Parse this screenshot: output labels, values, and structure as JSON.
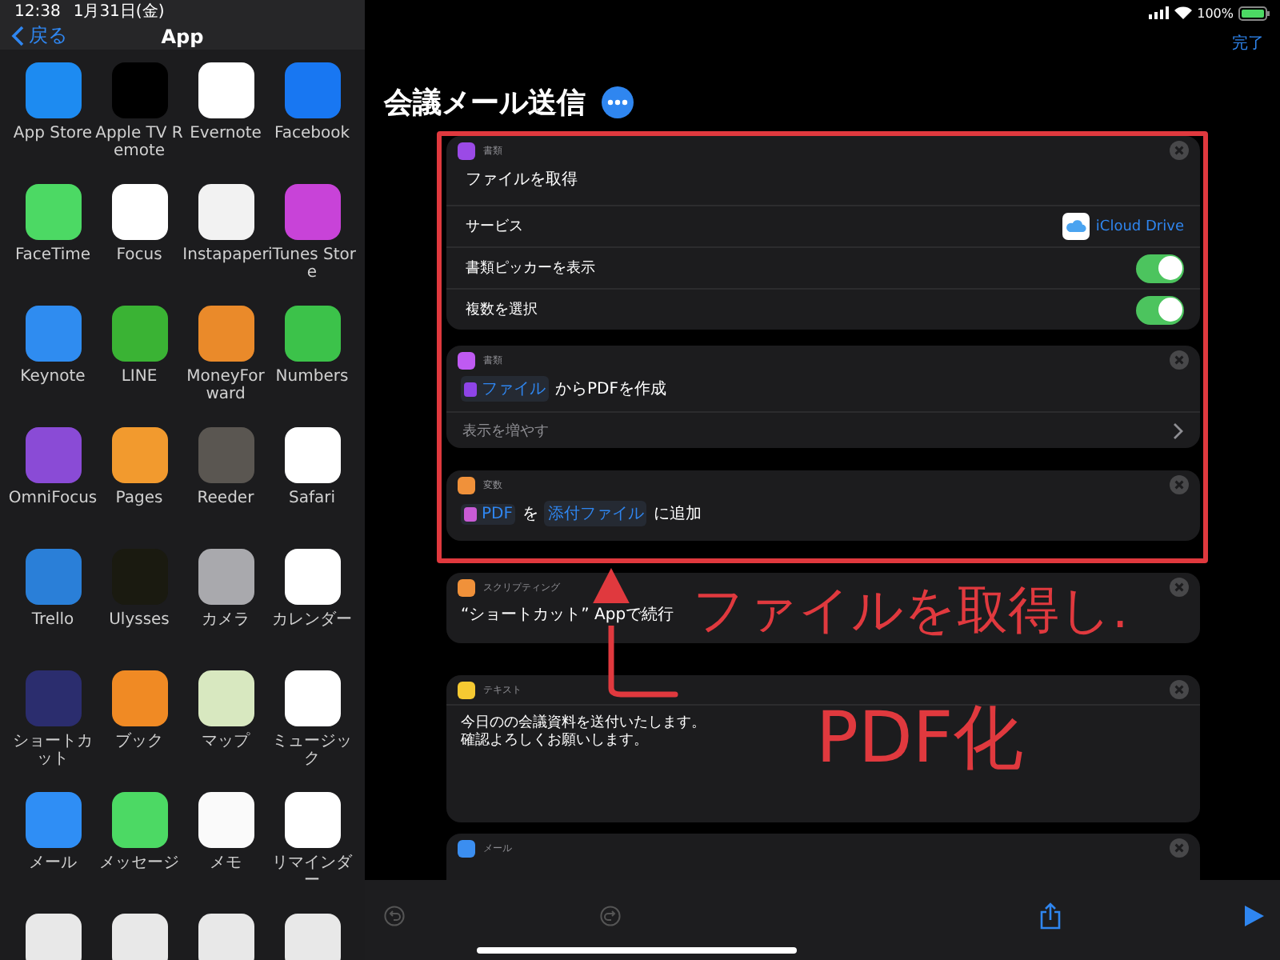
{
  "status_bar": {
    "time": "12:38",
    "date": "1月31日(金)",
    "battery": "100%"
  },
  "sidebar": {
    "back": "戻る",
    "title": "App",
    "apps": [
      {
        "name": "App Store",
        "color": "#1d8bf1"
      },
      {
        "name": "Apple TV Remote",
        "color": "#000000"
      },
      {
        "name": "Evernote",
        "color": "#ffffff"
      },
      {
        "name": "Facebook",
        "color": "#1877f2"
      },
      {
        "name": "FaceTime",
        "color": "#4cd964"
      },
      {
        "name": "Focus",
        "color": "#ffffff"
      },
      {
        "name": "Instapaper",
        "color": "#f2f2f2"
      },
      {
        "name": "iTunes Store",
        "color": "#c843d8"
      },
      {
        "name": "Keynote",
        "color": "#2f8cf0"
      },
      {
        "name": "LINE",
        "color": "#3ab334"
      },
      {
        "name": "MoneyForward",
        "color": "#ea8a2a"
      },
      {
        "name": "Numbers",
        "color": "#3cc24a"
      },
      {
        "name": "OmniFocus",
        "color": "#8a4bd6"
      },
      {
        "name": "Pages",
        "color": "#f29a2e"
      },
      {
        "name": "Reeder",
        "color": "#5a5651"
      },
      {
        "name": "Safari",
        "color": "#ffffff"
      },
      {
        "name": "Trello",
        "color": "#2a7fd8"
      },
      {
        "name": "Ulysses",
        "color": "#1a1a10"
      },
      {
        "name": "カメラ",
        "color": "#a9a9ad"
      },
      {
        "name": "カレンダー",
        "color": "#ffffff"
      },
      {
        "name": "ショートカット",
        "color": "#2b2d6e"
      },
      {
        "name": "ブック",
        "color": "#f08a24"
      },
      {
        "name": "マップ",
        "color": "#d8e8c0"
      },
      {
        "name": "ミュージック",
        "color": "#ffffff"
      },
      {
        "name": "メール",
        "color": "#2f8ef5"
      },
      {
        "name": "メッセージ",
        "color": "#4cd964"
      },
      {
        "name": "メモ",
        "color": "#fafafa"
      },
      {
        "name": "リマインダー",
        "color": "#ffffff"
      }
    ]
  },
  "editor": {
    "done": "完了",
    "title": "会議メール送信",
    "actions": [
      {
        "kind": "rows",
        "category": "書類",
        "color": "#9b4ae6",
        "title": "ファイルを取得",
        "rows": [
          {
            "kind": "value",
            "label": "サービス",
            "value": "iCloud Drive"
          },
          {
            "kind": "toggle",
            "label": "書類ピッカーを表示",
            "on": true
          },
          {
            "kind": "toggle",
            "label": "複数を選択",
            "on": true
          }
        ]
      },
      {
        "kind": "phrase",
        "category": "書類",
        "color": "#bf5af2",
        "parts": [
          {
            "kind": "token",
            "text": "ファイル",
            "color": "#8e44e8"
          },
          {
            "kind": "plain",
            "text": "からPDFを作成"
          }
        ],
        "more": "表示を増やす"
      },
      {
        "kind": "phrase",
        "category": "変数",
        "color": "#f0913a",
        "parts": [
          {
            "kind": "token",
            "text": "PDF",
            "color": "#c85bd6"
          },
          {
            "kind": "plain",
            "text": "を"
          },
          {
            "kind": "token",
            "text": "添付ファイル"
          },
          {
            "kind": "plain",
            "text": "に追加"
          }
        ]
      },
      {
        "kind": "phrase",
        "category": "スクリプティング",
        "color": "#f0913a",
        "parts": [
          {
            "kind": "plain",
            "text": "“ショートカット” Appで続行"
          }
        ]
      },
      {
        "kind": "text",
        "category": "テキスト",
        "color": "#f5c932",
        "body": [
          "今日のの会議資料を送付いたします。",
          "確認よろしくお願いします。"
        ]
      },
      {
        "kind": "header",
        "category": "メール",
        "color": "#3b8ef0"
      }
    ]
  },
  "annotation": {
    "lines": [
      "ファイルを取得し.",
      "PDF化"
    ]
  }
}
